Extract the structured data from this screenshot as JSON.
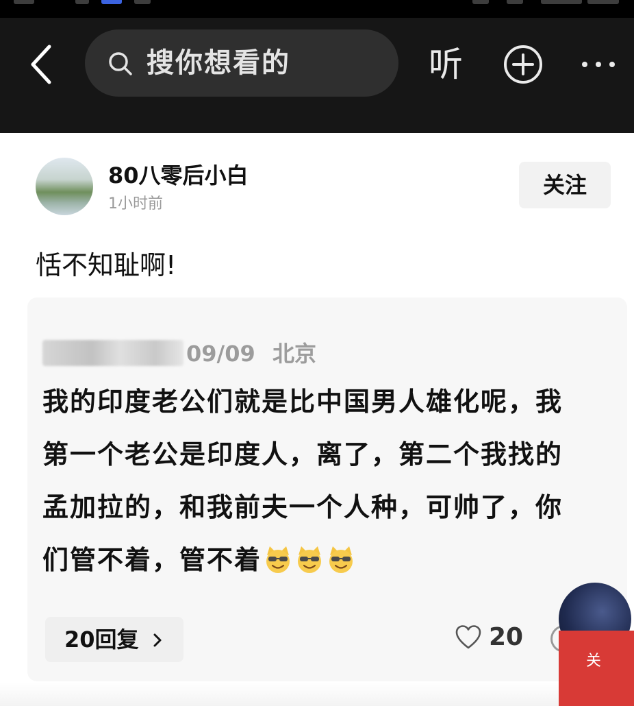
{
  "header": {
    "search_placeholder": "搜你想看的",
    "listen_label": "听"
  },
  "post": {
    "username": "80八零后小白",
    "time": "1小时前",
    "follow_label": "关注",
    "text": "恬不知耻啊!"
  },
  "quoted_comment": {
    "date": "09/09",
    "location": "北京",
    "text": "我的印度老公们就是比中国男人雄化呢，我第一个老公是印度人，离了，第二个我找的孟加拉的，和我前夫一个人种，可帅了，你们管不着，管不着",
    "emoji_icon": "smiling-cat-sunglasses-emoji",
    "reply_label": "20回复",
    "like_count": "20"
  },
  "floating_widget": {
    "label": "关"
  },
  "colors": {
    "topbar_bg": "#161616",
    "search_bg": "#2f2f2f",
    "card_bg": "#f7f7f7",
    "widget_red": "#d83a36"
  }
}
